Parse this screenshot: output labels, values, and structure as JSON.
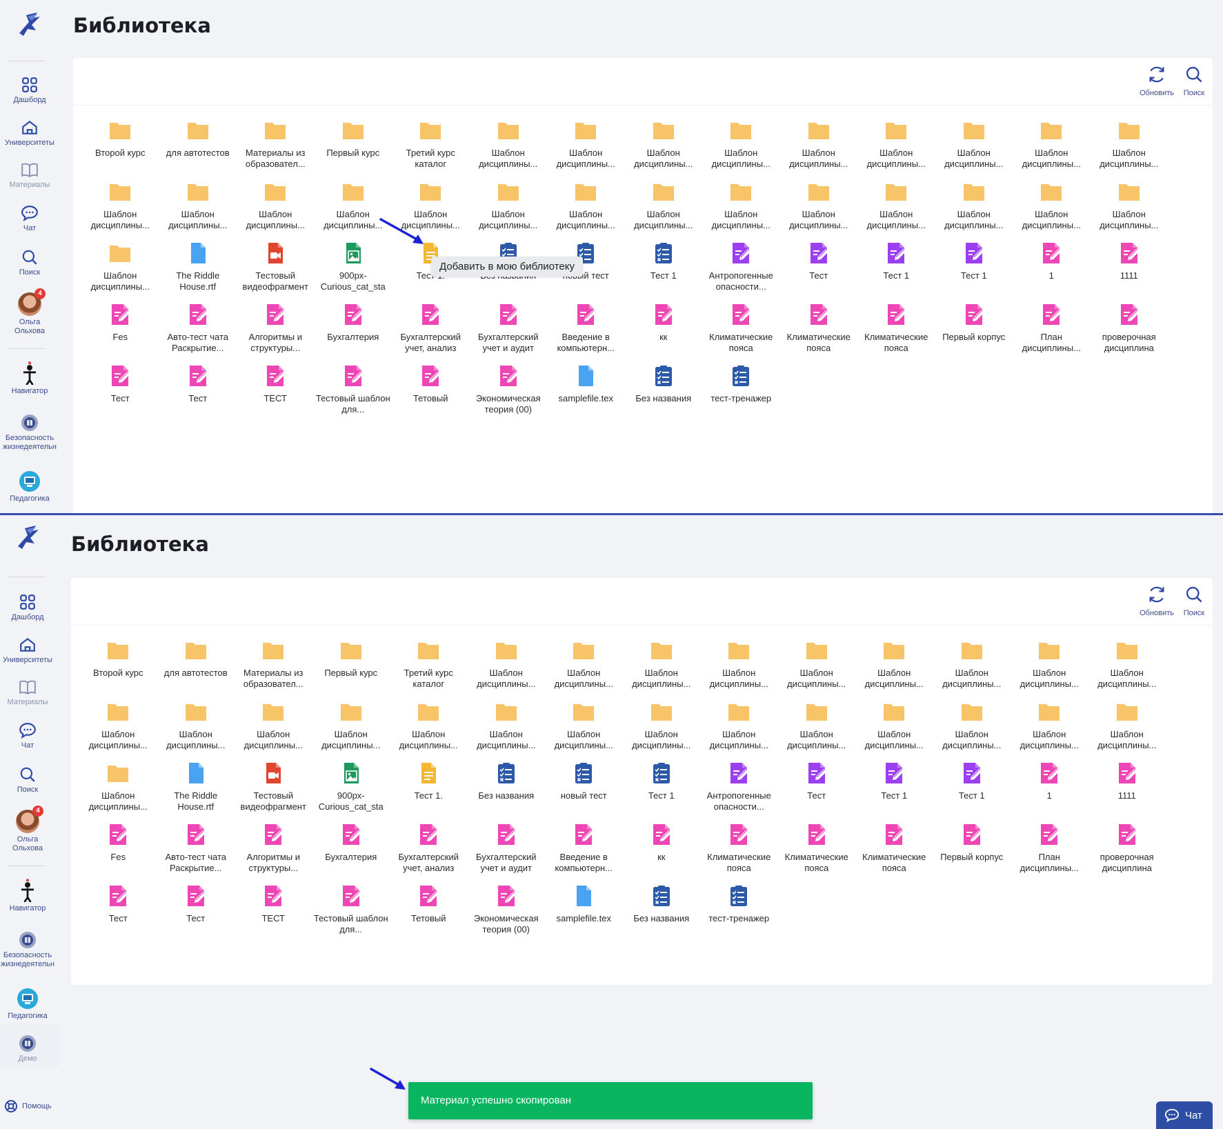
{
  "sidebar": {
    "items": [
      {
        "label": "Дашборд",
        "icon": "dashboard-icon"
      },
      {
        "label": "Университеты",
        "icon": "university-icon"
      },
      {
        "label": "Материалы",
        "icon": "book-icon"
      },
      {
        "label": "Чат",
        "icon": "chat-icon"
      },
      {
        "label": "Поиск",
        "icon": "search-icon"
      }
    ],
    "user": {
      "name": "Ольга Ольхова",
      "badge": "4"
    },
    "extra": [
      {
        "label": "Навигатор",
        "icon": "navigator-icon"
      },
      {
        "label": "Безопасность жизнедеятельн",
        "icon": "course-icon"
      },
      {
        "label": "Педагогика",
        "icon": "pedagogy-icon"
      }
    ],
    "demo": {
      "label": "Демо",
      "icon": "course-icon"
    },
    "help": {
      "label": "Помощь",
      "icon": "help-icon"
    }
  },
  "page": {
    "title": "Библиотека"
  },
  "toolbar": {
    "refresh_label": "Обновить",
    "search_label": "Поиск"
  },
  "top_items": [
    {
      "name": "Второй курс",
      "type": "folder"
    },
    {
      "name": "для автотестов",
      "type": "folder"
    },
    {
      "name": "Материалы из образовател...",
      "type": "folder"
    },
    {
      "name": "Первый курс",
      "type": "folder"
    },
    {
      "name": "Третий курс каталог",
      "type": "folder"
    },
    {
      "name": "Шаблон дисциплины...",
      "type": "folder"
    },
    {
      "name": "Шаблон дисциплины...",
      "type": "folder"
    },
    {
      "name": "Шаблон дисциплины...",
      "type": "folder"
    },
    {
      "name": "Шаблон дисциплины...",
      "type": "folder"
    },
    {
      "name": "Шаблон дисциплины...",
      "type": "folder"
    },
    {
      "name": "Шаблон дисциплины...",
      "type": "folder"
    },
    {
      "name": "Шаблон дисциплины...",
      "type": "folder"
    },
    {
      "name": "Шаблон дисциплины...",
      "type": "folder"
    },
    {
      "name": "Шаблон дисциплины...",
      "type": "folder"
    },
    {
      "name": "Шаблон дисциплины...",
      "type": "folder"
    },
    {
      "name": "Шаблон дисциплины...",
      "type": "folder"
    },
    {
      "name": "Шаблон дисциплины...",
      "type": "folder"
    },
    {
      "name": "Шаблон дисциплины...",
      "type": "folder"
    },
    {
      "name": "Шаблон дисциплины...",
      "type": "folder"
    },
    {
      "name": "Шаблон дисциплины...",
      "type": "folder"
    },
    {
      "name": "Шаблон дисциплины...",
      "type": "folder"
    },
    {
      "name": "Шаблон дисциплины...",
      "type": "folder"
    },
    {
      "name": "Шаблон дисциплины...",
      "type": "folder"
    },
    {
      "name": "Шаблон дисциплины...",
      "type": "folder"
    },
    {
      "name": "Шаблон дисциплины...",
      "type": "folder"
    },
    {
      "name": "Шаблон дисциплины...",
      "type": "folder"
    },
    {
      "name": "Шаблон дисциплины...",
      "type": "folder"
    },
    {
      "name": "Шаблон дисциплины...",
      "type": "folder"
    },
    {
      "name": "Шаблон дисциплины...",
      "type": "folder"
    },
    {
      "name": "The Riddle House.rtf",
      "type": "doc-blue"
    },
    {
      "name": "Тестовый видеофрагмент",
      "type": "video"
    },
    {
      "name": "900px-Curious_cat_sta",
      "type": "image"
    },
    {
      "name": "Тест 1.",
      "type": "doc-yellow"
    },
    {
      "name": "Без названия",
      "type": "quiz"
    },
    {
      "name": "новый тест",
      "type": "quiz"
    },
    {
      "name": "Тест 1",
      "type": "quiz"
    },
    {
      "name": "Антропогенные опасности...",
      "type": "task-purple"
    },
    {
      "name": "Тест",
      "type": "task-purple"
    },
    {
      "name": "Тест 1",
      "type": "task-purple"
    },
    {
      "name": "Тест 1",
      "type": "task-purple"
    },
    {
      "name": "1",
      "type": "task-pink"
    },
    {
      "name": "1111",
      "type": "task-pink"
    },
    {
      "name": "Fes",
      "type": "task-pink"
    },
    {
      "name": "Авто-тест чата Раскрытие...",
      "type": "task-pink"
    },
    {
      "name": "Алгоритмы и структуры...",
      "type": "task-pink"
    },
    {
      "name": "Бухгалтерия",
      "type": "task-pink"
    },
    {
      "name": "Бухгалтерский учет, анализ",
      "type": "task-pink"
    },
    {
      "name": "Бухгалтерский учет и аудит",
      "type": "task-pink"
    },
    {
      "name": "Введение в компьютерн...",
      "type": "task-pink"
    },
    {
      "name": "кк",
      "type": "task-pink"
    },
    {
      "name": "Климатические пояса",
      "type": "task-pink"
    },
    {
      "name": "Климатические пояса",
      "type": "task-pink"
    },
    {
      "name": "Климатические пояса",
      "type": "task-pink"
    },
    {
      "name": "Первый корпус",
      "type": "task-pink"
    },
    {
      "name": "План дисциплины...",
      "type": "task-pink"
    },
    {
      "name": "проверочная дисциплина",
      "type": "task-pink"
    },
    {
      "name": "Тест",
      "type": "task-pink"
    },
    {
      "name": "Тест",
      "type": "task-pink"
    },
    {
      "name": "ТЕСТ",
      "type": "task-pink"
    },
    {
      "name": "Тестовый шаблон для...",
      "type": "task-pink"
    },
    {
      "name": "Тетовый",
      "type": "task-pink"
    },
    {
      "name": "Экономическая теория (00)",
      "type": "task-pink"
    },
    {
      "name": "samplefile.tex",
      "type": "doc-blue"
    },
    {
      "name": "Без названия",
      "type": "quiz"
    },
    {
      "name": "тест-тренажер",
      "type": "quiz"
    }
  ],
  "tooltip": {
    "text": "Добавить в мою библиотеку"
  },
  "toast": {
    "text": "Материал успешно скопирован"
  },
  "chat_button": {
    "label": "Чат"
  },
  "colors": {
    "folder": "#f7c469",
    "doc_blue": "#4aa3f0",
    "video": "#e2452f",
    "image": "#1c9a5c",
    "doc_yellow": "#f5b731",
    "quiz": "#2d5aa8",
    "task_purple": "#9b3ff0",
    "task_pink": "#ee46b5",
    "toast": "#0ab55f",
    "accent": "#3a4a8a"
  }
}
